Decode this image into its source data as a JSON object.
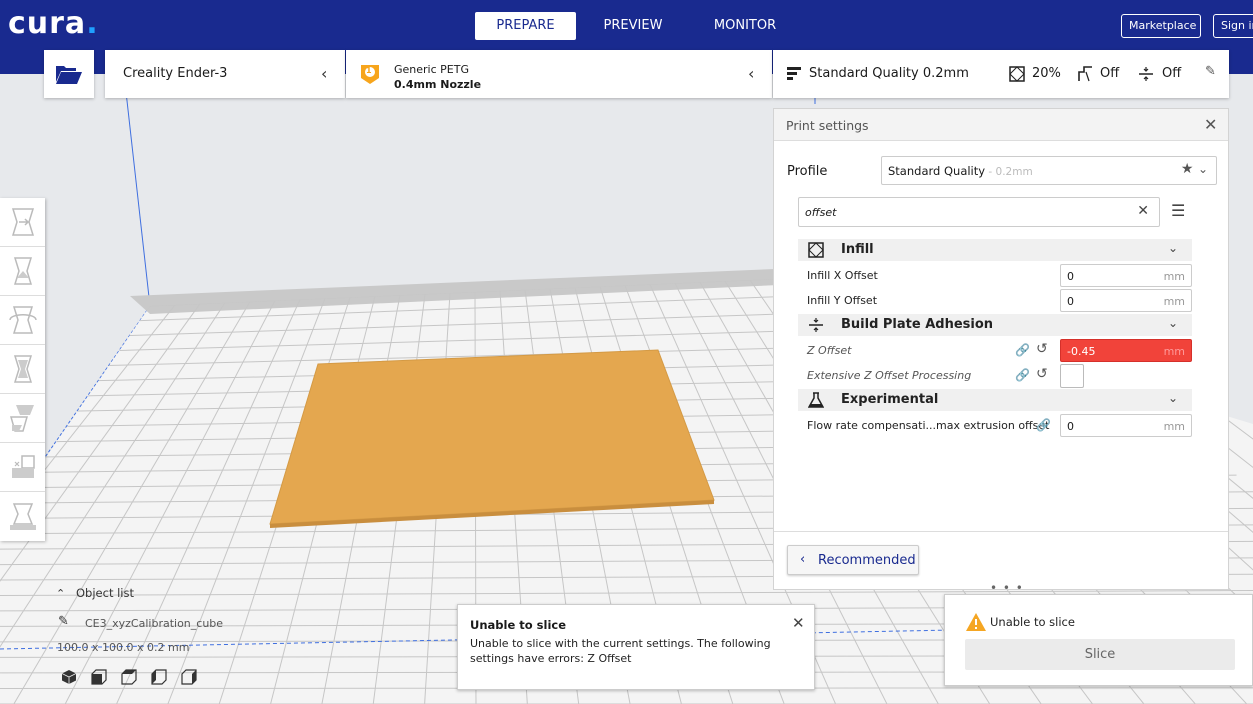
{
  "app": {
    "logo": "cura",
    "logo_dot": "."
  },
  "header": {
    "tabs": [
      {
        "label": "PREPARE",
        "active": true
      },
      {
        "label": "PREVIEW",
        "active": false
      },
      {
        "label": "MONITOR",
        "active": false
      }
    ],
    "marketplace_label": "Marketplace",
    "signin_label": "Sign in"
  },
  "machine_bar": {
    "machine_name": "Creality Ender-3",
    "extruder_number": "1",
    "material_name": "Generic PETG",
    "nozzle_name": "0.4mm Nozzle",
    "quality_name": "Standard Quality 0.2mm",
    "infill_value": "20%",
    "support_value": "Off",
    "adhesion_value": "Off"
  },
  "print_settings": {
    "title": "Print settings",
    "profile_label": "Profile",
    "profile_value": "Standard Quality",
    "profile_sub": " - 0.2mm",
    "search_value": "offset",
    "categories": [
      {
        "label": "Infill",
        "settings": [
          {
            "label": "Infill X Offset",
            "value": "0",
            "unit": "mm"
          },
          {
            "label": "Infill Y Offset",
            "value": "0",
            "unit": "mm"
          }
        ]
      },
      {
        "label": "Build Plate Adhesion",
        "settings": [
          {
            "label": "Z Offset",
            "value": "-0.45",
            "unit": "mm",
            "error": true
          },
          {
            "label": "Extensive Z Offset Processing",
            "type": "checkbox",
            "checked": false
          }
        ]
      },
      {
        "label": "Experimental",
        "settings": [
          {
            "label": "Flow rate compensati...max extrusion offset",
            "value": "0",
            "unit": "mm"
          }
        ]
      }
    ],
    "recommended_label": "Recommended",
    "handle": "• • •"
  },
  "object_list": {
    "toggle_label": "Object list",
    "object_name": "CE3_xyzCalibration_cube",
    "dimensions": "100.0 x 100.0 x 0.2 mm"
  },
  "error_message": {
    "title": "Unable to slice",
    "body": "Unable to slice with the current settings. The following settings have errors: Z Offset"
  },
  "slice_panel": {
    "status": "Unable to slice",
    "button_label": "Slice"
  },
  "colors": {
    "header": "#192a8f",
    "model": "#e4a74f",
    "error": "#f1433a",
    "accent_blue": "#1fa0ff"
  },
  "icons": {
    "open_file": "folder-open-icon",
    "tools": [
      "move-icon",
      "scale-icon",
      "rotate-icon",
      "mirror-icon",
      "per-model-settings-icon",
      "support-blocker-icon",
      "measure-icon"
    ],
    "views": [
      "3d-view-icon",
      "front-view-icon",
      "top-view-icon",
      "left-view-icon",
      "right-view-icon"
    ]
  }
}
